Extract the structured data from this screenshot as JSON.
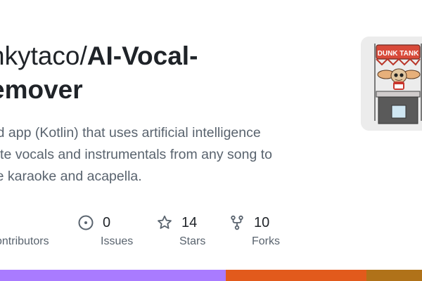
{
  "repo": {
    "owner": "nkytaco/",
    "name": "AI-Vocal-",
    "name_line2": "emover"
  },
  "description": {
    "line1": "roid app (Kotlin) that uses artificial intelligence",
    "line2": "plate vocals and instrumentals from any song to",
    "line3": "uce karaoke and acapella."
  },
  "stats": {
    "contributors": {
      "label": "ontributors"
    },
    "issues": {
      "value": "0",
      "label": "Issues",
      "icon": "issue-circle-icon"
    },
    "stars": {
      "value": "14",
      "label": "Stars",
      "icon": "star-icon"
    },
    "forks": {
      "value": "10",
      "label": "Forks",
      "icon": "fork-icon"
    }
  },
  "avatar": {
    "sign_text": "DUNK TANK"
  },
  "languages": [
    {
      "color": "#a97bff"
    },
    {
      "color": "#e25a1c"
    },
    {
      "color": "#b07219"
    }
  ],
  "language_shares": [
    0.535,
    0.333,
    0.132
  ]
}
